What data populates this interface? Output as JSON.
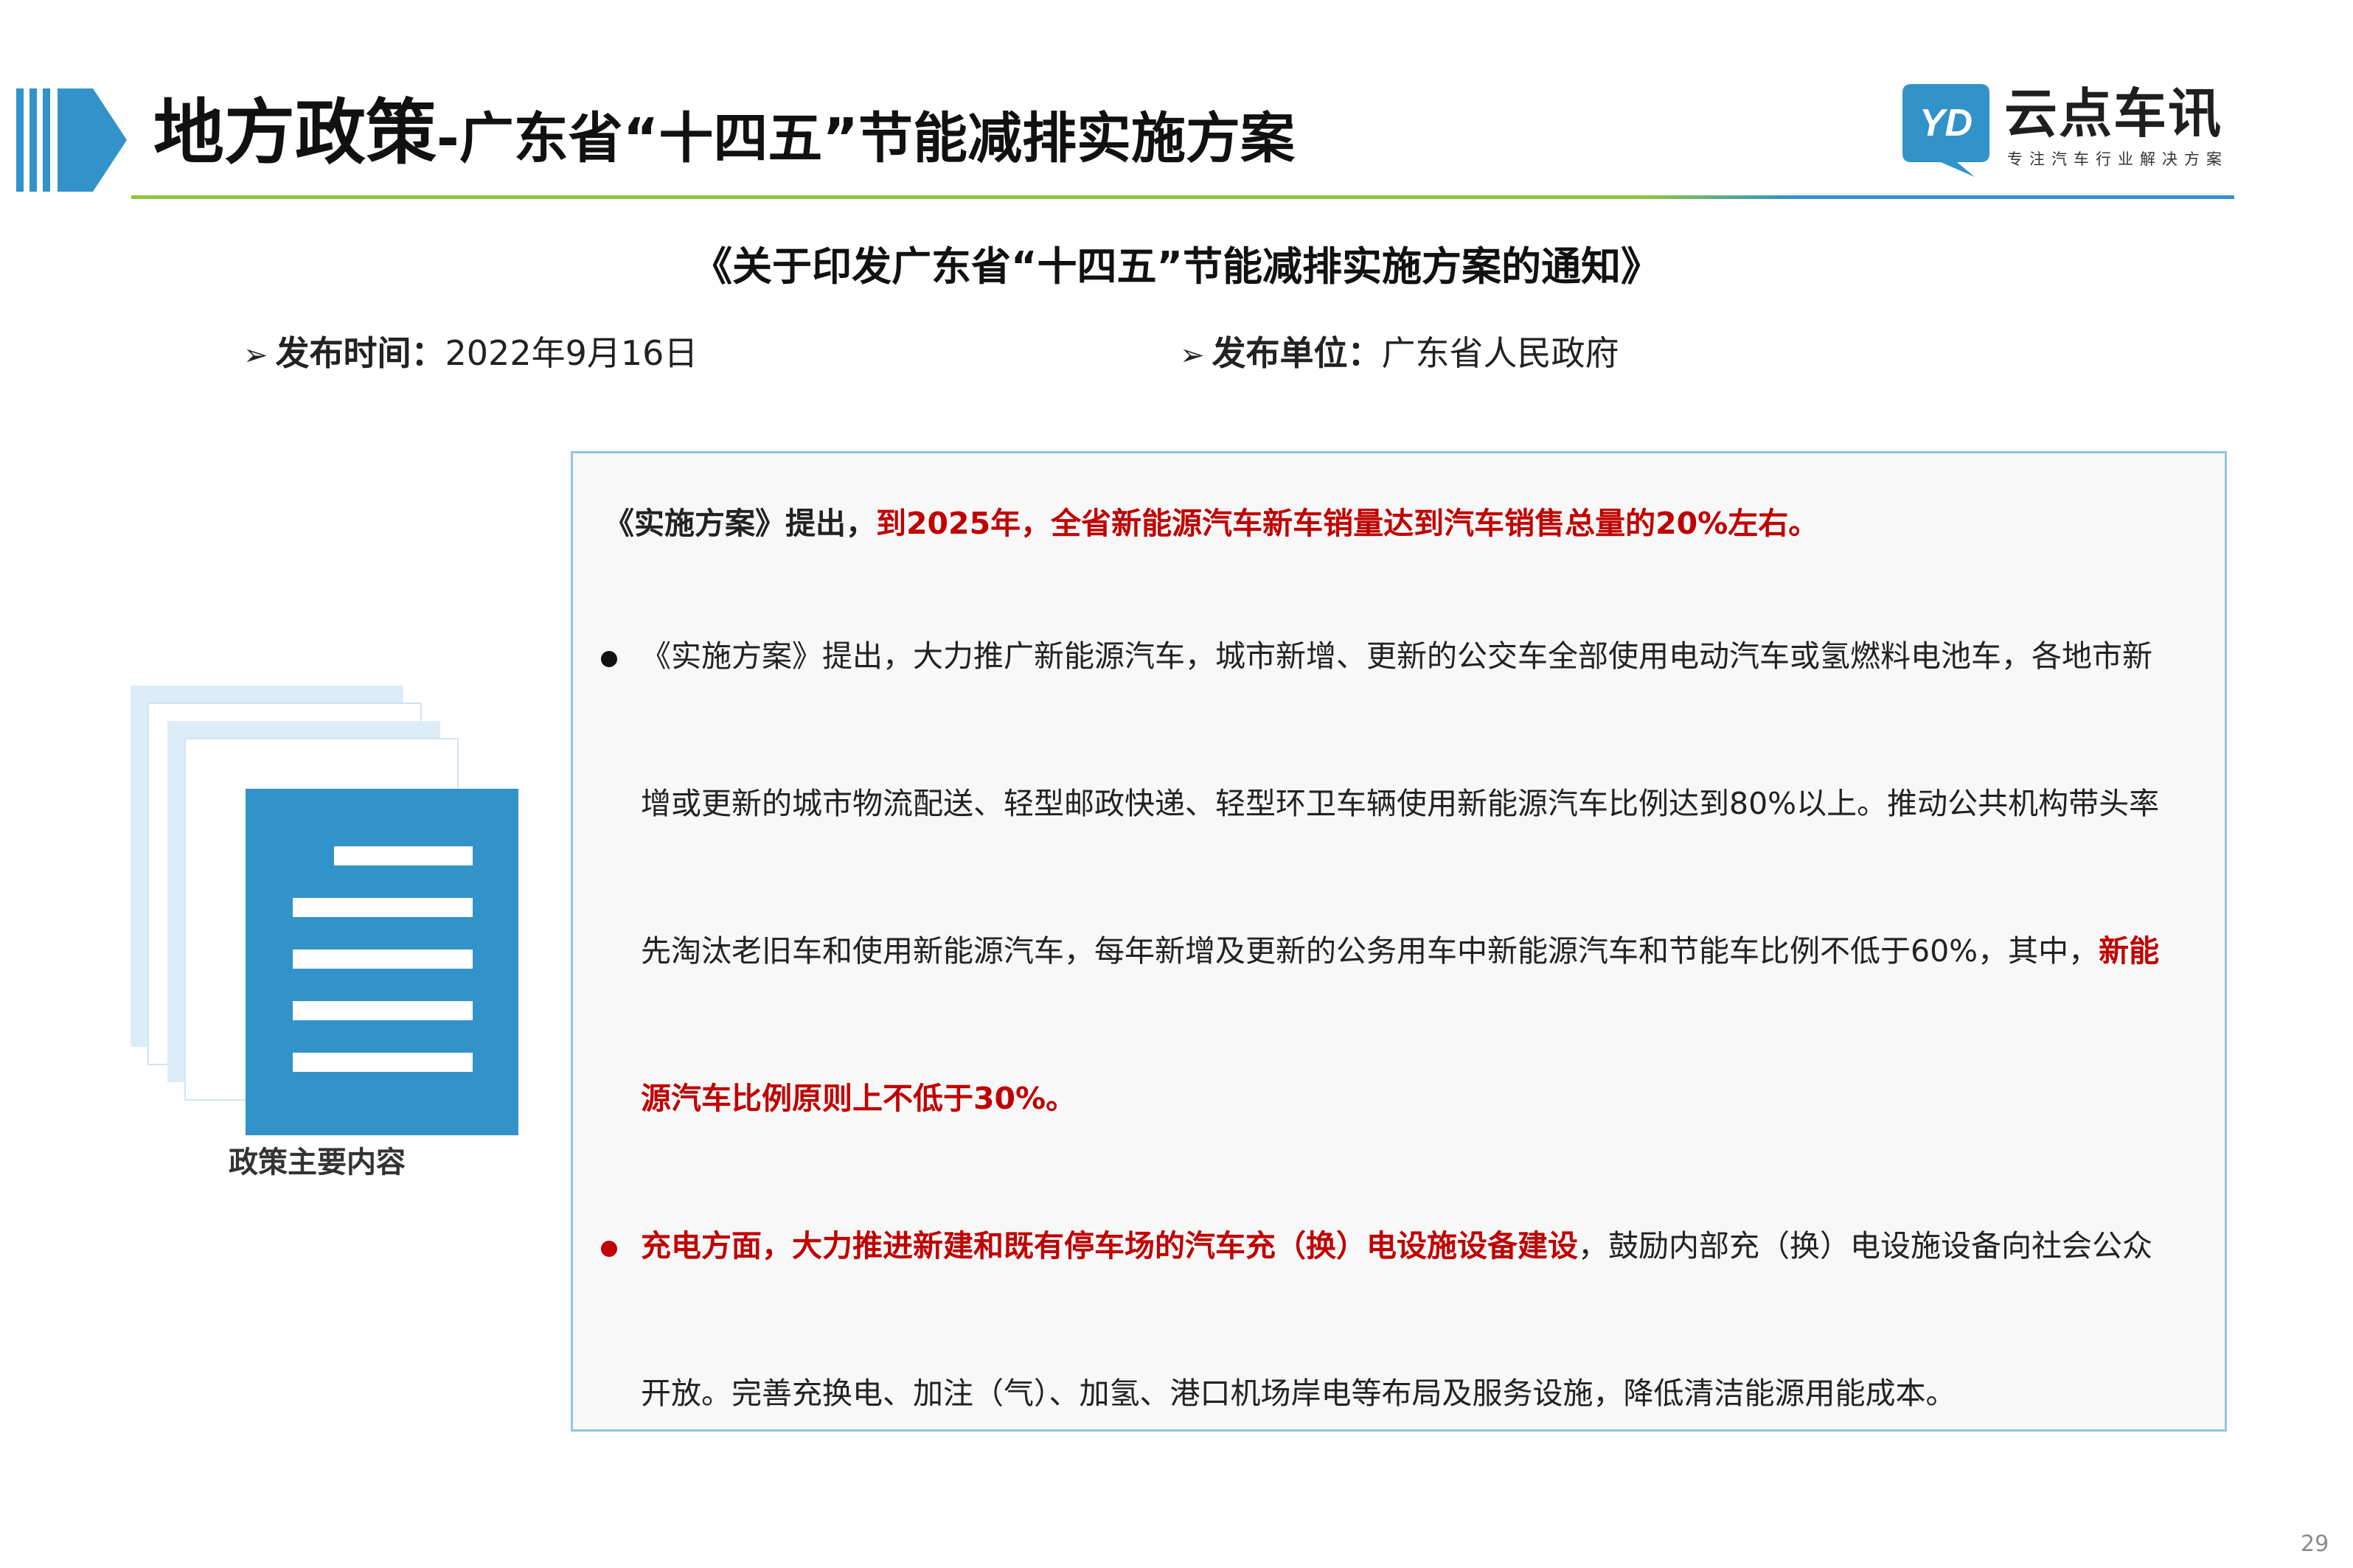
{
  "header": {
    "title_main": "地方政策",
    "title_sub": "-广东省“十四五”节能减排实施方案"
  },
  "logo": {
    "badge_text": "YD",
    "name": "云点车讯",
    "tagline": "专注汽车行业解决方案"
  },
  "notice": {
    "title": "《关于印发广东省“十四五”节能减排实施方案的通知》",
    "date_label": "发布时间：",
    "date_value": "2022年9月16日",
    "issuer_label": "发布单位：",
    "issuer_value": "广东省人民政府",
    "arrow_icon": "➢"
  },
  "illustration": {
    "icon": "document-stack-icon",
    "caption": "政策主要内容"
  },
  "content": {
    "headline_prefix": "《实施方案》提出，",
    "headline_highlight": "到2025年，全省新能源汽车新车销量达到汽车销售总量的20%左右。",
    "p1_line1": "《实施方案》提出，大力推广新能源汽车，城市新增、更新的公交车全部使用电动汽车或氢燃料电池车，各地市新",
    "p1_line2": "增或更新的城市物流配送、轻型邮政快递、轻型环卫车辆使用新能源汽车比例达到80%以上。推动公共机构带头率",
    "p1_line3_plain": "先淘汰老旧车和使用新能源汽车，每年新增及更新的公务用车中新能源汽车和节能车比例不低于60%，其中，",
    "p1_line3_highlight": "新能",
    "p1_line4_highlight": "源汽车比例原则上不低于30%。",
    "p2_line1_highlight": "充电方面，大力推进新建和既有停车场的汽车充（换）电设施设备建设",
    "p2_line1_plain": "，鼓励内部充（换）电设施设备向社会公众",
    "p2_line2": "开放。完善充换电、加注（气）、加氢、港口机场岸电等布局及服务设施，降低清洁能源用能成本。"
  },
  "colors": {
    "accent_blue": "#3193c9",
    "light_blue": "#dcedf8",
    "green_line": "#8dc63f",
    "highlight_red": "#c00000",
    "box_border": "#8fc6e4"
  },
  "page_number": "29"
}
